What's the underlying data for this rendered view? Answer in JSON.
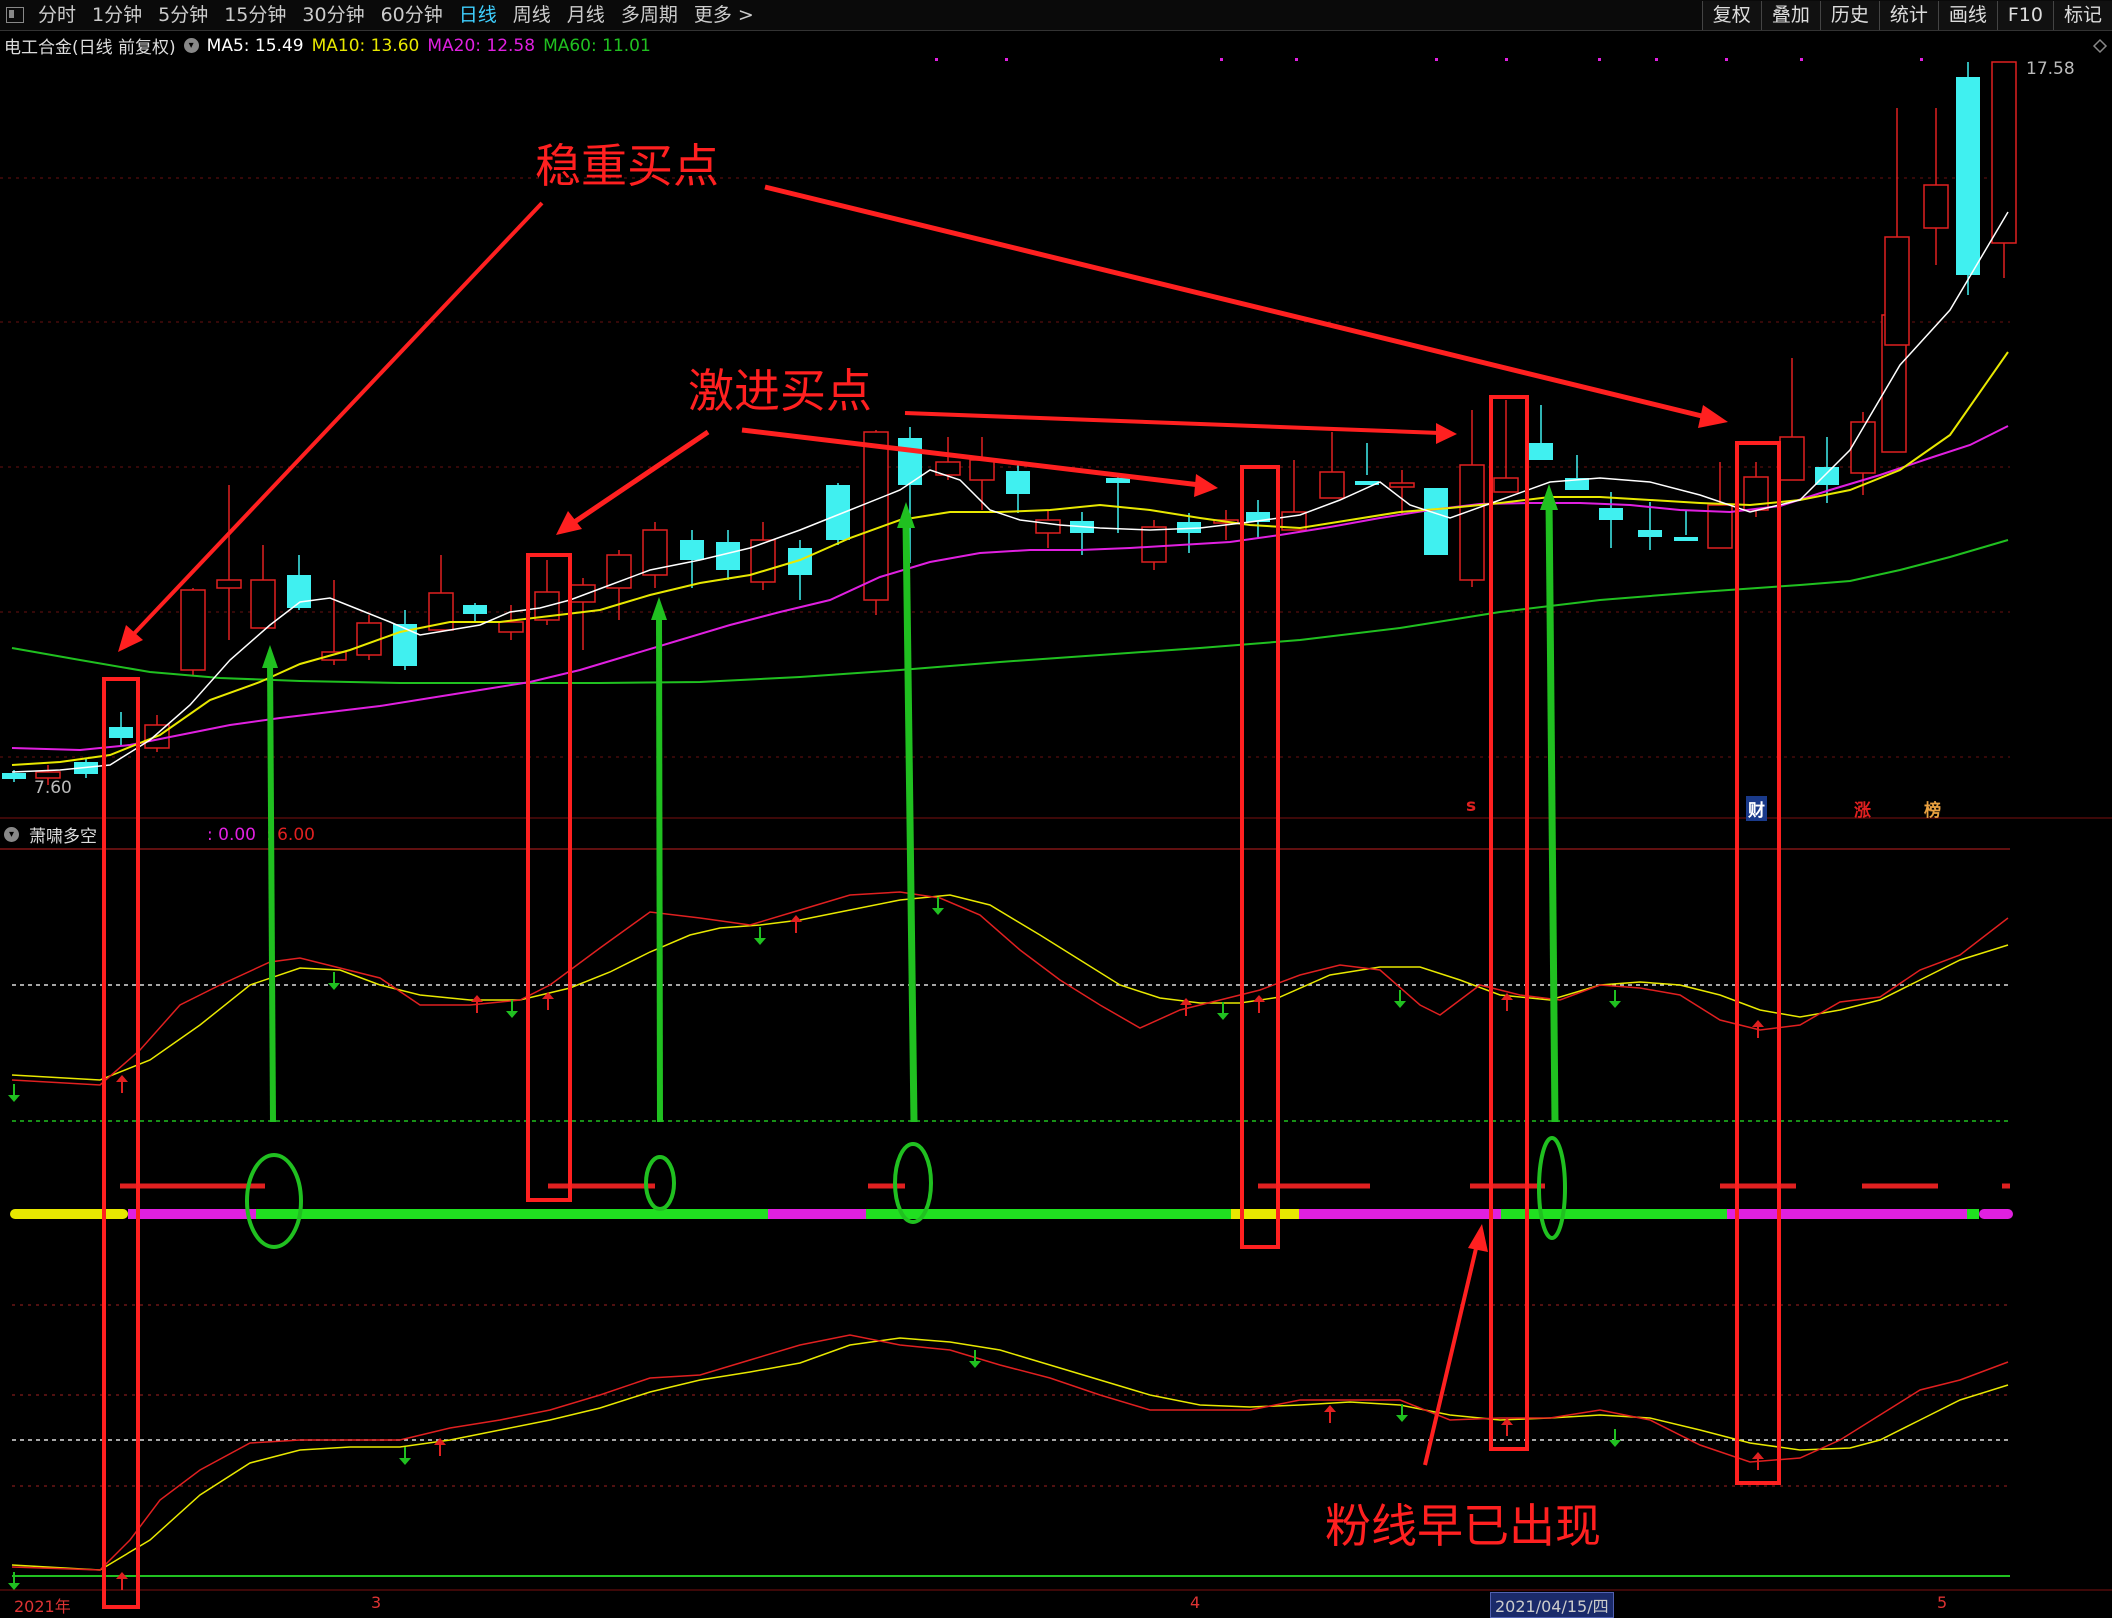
{
  "toolbar": {
    "periods": [
      "分时",
      "1分钟",
      "5分钟",
      "15分钟",
      "30分钟",
      "60分钟",
      "日线",
      "周线",
      "月线",
      "多周期",
      "更多 >"
    ],
    "active_period": "日线",
    "right_buttons": [
      "复权",
      "叠加",
      "历史",
      "统计",
      "画线",
      "F10",
      "标记"
    ]
  },
  "main_chart": {
    "stock_title": "电工合金(日线 前复权)",
    "ma5": "MA5: 15.49",
    "ma10": "MA10: 13.60",
    "ma20": "MA20: 12.58",
    "ma60": "MA60: 11.01",
    "high_label": "17.58",
    "low_label": "7.60",
    "colors": {
      "ma5": "#ffffff",
      "ma10": "#e8e800",
      "ma20": "#e020e0",
      "ma60": "#20c020",
      "candle_up": "#e02020",
      "candle_down": "#40f0f0"
    }
  },
  "indicator": {
    "name": "萧啸多空",
    "value1": ": 0.00",
    "value2": ": 6.00"
  },
  "markers": {
    "s": "s",
    "cai": "财",
    "zhang": "涨",
    "bang": "榜"
  },
  "x_axis": {
    "d1": "2021年",
    "d2": "3",
    "d3": "4",
    "d4": "2021/04/15/四",
    "d5": "5"
  },
  "annotations": {
    "steady_buy": "稳重买点",
    "aggressive_buy": "激进买点",
    "pink_line": "粉线早已出现"
  }
}
